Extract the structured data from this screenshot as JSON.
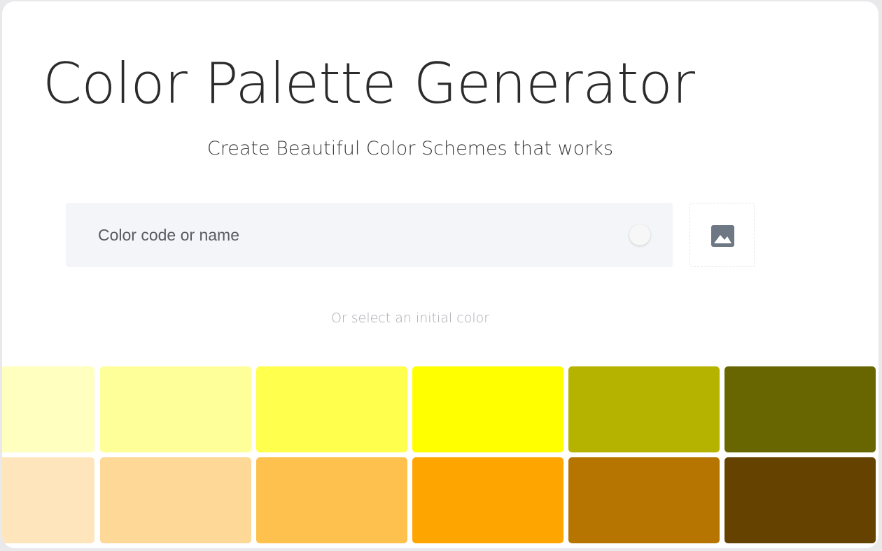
{
  "header": {
    "title": "Color Palette Generator",
    "subtitle": "Create Beautiful Color Schemes that works"
  },
  "search": {
    "placeholder": "Color code or name",
    "value": ""
  },
  "image_button": {
    "icon": "image-icon"
  },
  "hint": "Or select an initial color",
  "swatches": {
    "rows": [
      [
        "#ffffbf",
        "#ffff99",
        "#ffff4d",
        "#ffff00",
        "#b6b300",
        "#676600"
      ],
      [
        "#fee5bc",
        "#fdd896",
        "#fec14e",
        "#fea500",
        "#b57500",
        "#664200"
      ]
    ]
  }
}
